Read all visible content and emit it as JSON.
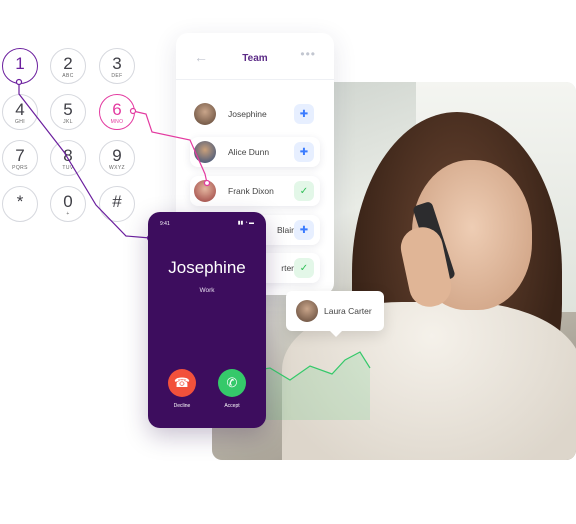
{
  "team": {
    "title": "Team",
    "back_icon": "arrow-left-icon",
    "more_icon": "more-horizontal-icon",
    "members": [
      {
        "name": "Josephine",
        "action": "add-user"
      },
      {
        "name": "Alice Dunn",
        "action": "add-user"
      },
      {
        "name": "Frank Dixon",
        "action": "check"
      },
      {
        "name": "Blair",
        "action": "add-user"
      },
      {
        "name": "rter",
        "action": "check"
      }
    ]
  },
  "dialpad": {
    "keys": [
      {
        "digit": "1",
        "letters": ""
      },
      {
        "digit": "2",
        "letters": "ABC"
      },
      {
        "digit": "3",
        "letters": "DEF"
      },
      {
        "digit": "4",
        "letters": "GHI"
      },
      {
        "digit": "5",
        "letters": "JKL"
      },
      {
        "digit": "6",
        "letters": "MNO"
      },
      {
        "digit": "7",
        "letters": "PQRS"
      },
      {
        "digit": "8",
        "letters": "TUV"
      },
      {
        "digit": "9",
        "letters": "WXYZ"
      },
      {
        "digit": "*",
        "letters": ""
      },
      {
        "digit": "0",
        "letters": "+"
      },
      {
        "digit": "#",
        "letters": ""
      }
    ]
  },
  "call": {
    "status_time": "9:41",
    "caller_name": "Josephine",
    "caller_label": "Work",
    "decline_label": "Decline",
    "accept_label": "Accept"
  },
  "tooltip": {
    "name": "Laura Carter"
  },
  "colors": {
    "purple": "#3d0d5e",
    "accent_purple": "#6b1f9e",
    "pink": "#e33aa0",
    "green": "#35c96a",
    "red": "#f2513b",
    "blue": "#3a7bff"
  }
}
